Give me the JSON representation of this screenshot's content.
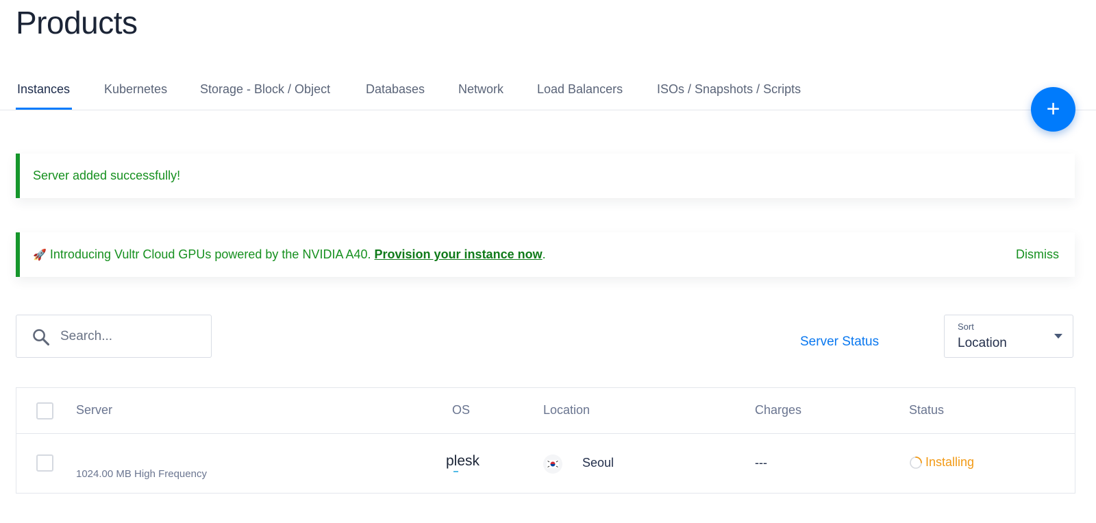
{
  "page": {
    "title": "Products"
  },
  "tabs": [
    {
      "label": "Instances",
      "active": true
    },
    {
      "label": "Kubernetes"
    },
    {
      "label": "Storage - Block / Object"
    },
    {
      "label": "Databases"
    },
    {
      "label": "Network"
    },
    {
      "label": "Load Balancers"
    },
    {
      "label": "ISOs / Snapshots / Scripts"
    }
  ],
  "fab": {
    "label": "+"
  },
  "alerts": {
    "success": {
      "message": "Server added successfully!"
    },
    "promo": {
      "icon": "rocket-icon",
      "message": "Introducing Vultr Cloud GPUs powered by the NVIDIA A40.",
      "link": "Provision your instance now",
      "suffix": ".",
      "dismiss": "Dismiss"
    }
  },
  "search": {
    "placeholder": "Search...",
    "value": ""
  },
  "toolbar": {
    "server_status": "Server Status"
  },
  "sort": {
    "label": "Sort",
    "value": "Location"
  },
  "table": {
    "columns": [
      "Server",
      "OS",
      "Location",
      "Charges",
      "Status"
    ],
    "rows": [
      {
        "server_name": "",
        "server_plan": "1024.00 MB High Frequency",
        "os": "plesk",
        "location": "Seoul",
        "flag": "south-korea-flag",
        "charges": "---",
        "status": "Installing"
      }
    ]
  },
  "colors": {
    "accent": "#007bfc",
    "success": "#16901f",
    "status_installing": "#f29a16"
  }
}
